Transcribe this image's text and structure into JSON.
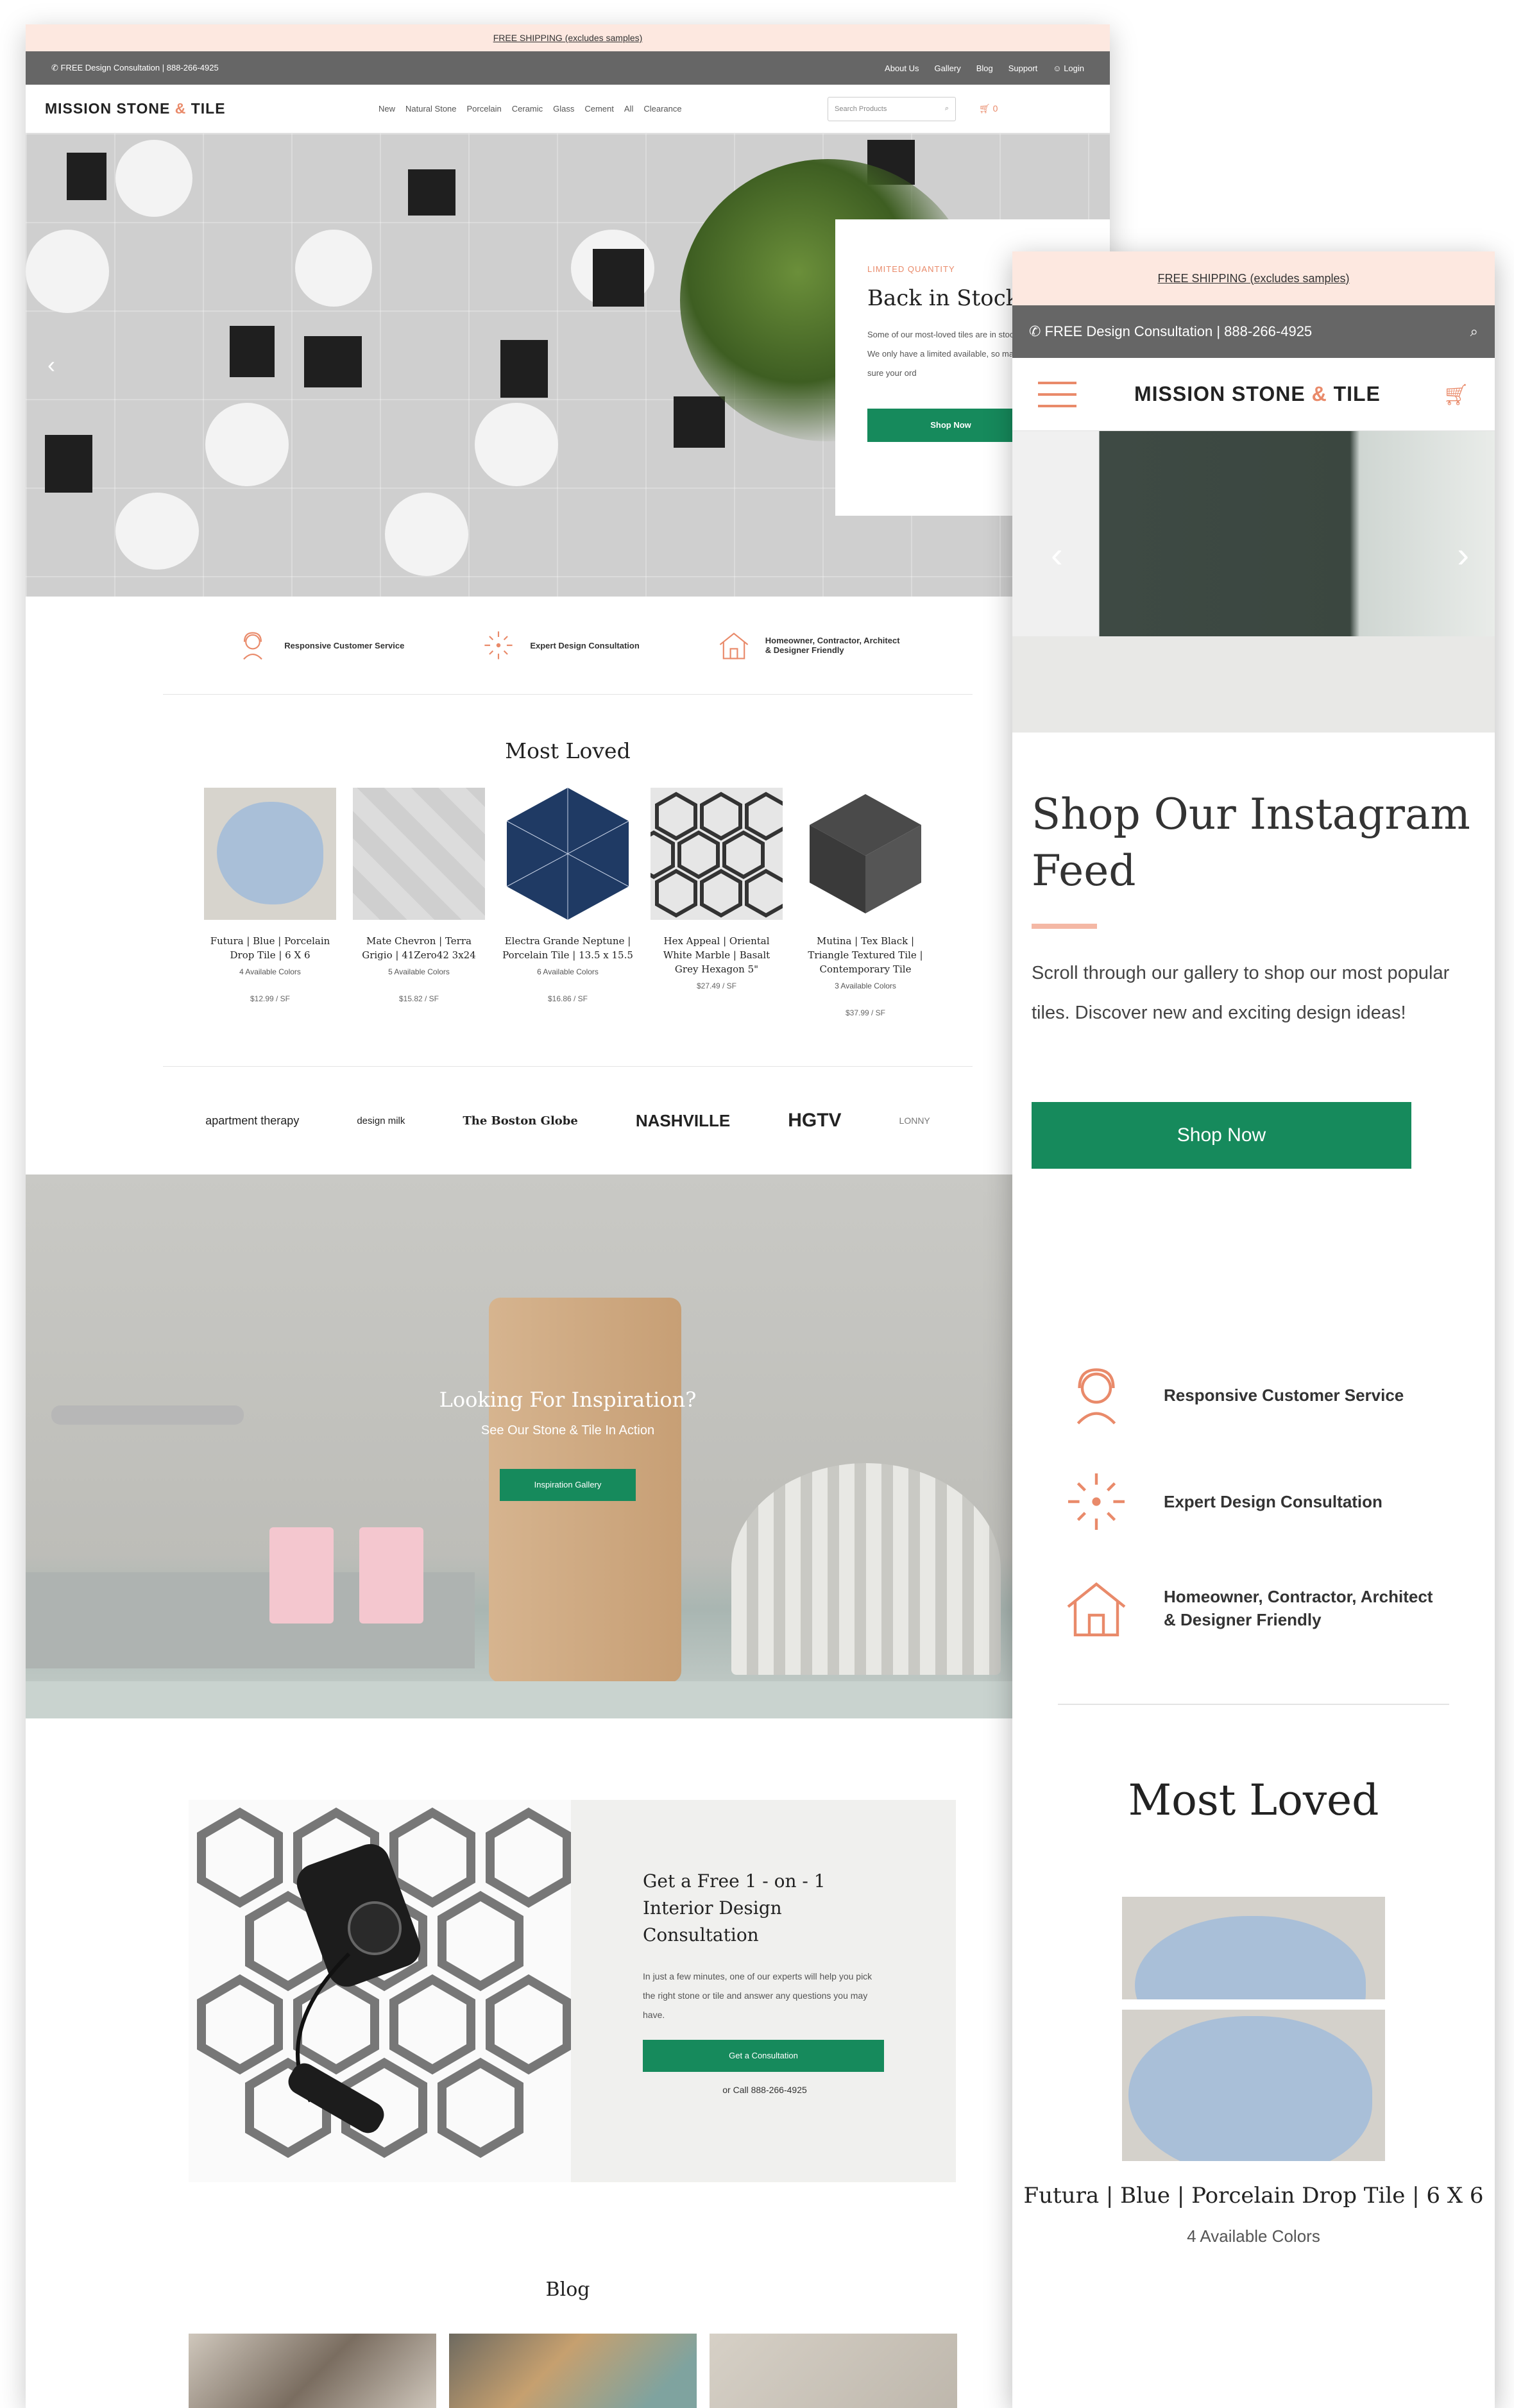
{
  "desktop": {
    "shipping_banner": "FREE SHIPPING (excludes samples)",
    "utility": {
      "phone_text": "FREE Design Consultation | 888-266-4925",
      "links": [
        "About Us",
        "Gallery",
        "Blog",
        "Support",
        "Login"
      ]
    },
    "logo": {
      "part1": "MISSION STONE",
      "amp": "&",
      "part2": "TILE"
    },
    "nav_items": [
      "New",
      "Natural Stone",
      "Porcelain",
      "Ceramic",
      "Glass",
      "Cement",
      "All",
      "Clearance"
    ],
    "search_placeholder": "Search Products",
    "cart_count": "0",
    "hero": {
      "kicker": "LIMITED QUANTITY",
      "title": "Back in Stock",
      "body": "Some of our most-loved tiles are in stock. We only have a limited available, so make sure your ord",
      "button": "Shop Now"
    },
    "features": [
      "Responsive Customer Service",
      "Expert Design Consultation",
      "Homeowner, Contractor, Architect & Designer Friendly"
    ],
    "most_loved_title": "Most Loved",
    "products": [
      {
        "name": "Futura | Blue | Porcelain Drop Tile | 6 X 6",
        "colors": "4 Available Colors",
        "price": "$12.99 / SF"
      },
      {
        "name": "Mate Chevron | Terra Grigio | 41Zero42 3x24",
        "colors": "5 Available Colors",
        "price": "$15.82 / SF"
      },
      {
        "name": "Electra Grande Neptune | Porcelain Tile | 13.5 x 15.5",
        "colors": "6 Available Colors",
        "price": "$16.86 / SF"
      },
      {
        "name": "Hex Appeal | Oriental White Marble | Basalt Grey Hexagon 5\"",
        "colors": "",
        "price": "$27.49 / SF"
      },
      {
        "name": "Mutina | Tex Black | Triangle Textured Tile | Contemporary Tile",
        "colors": "3 Available Colors",
        "price": "$37.99 / SF"
      }
    ],
    "press": [
      "apartment therapy",
      "design milk",
      "The Boston Globe",
      "NASHVILLE",
      "HGTV",
      "LONNY"
    ],
    "inspiration": {
      "title": "Looking For Inspiration?",
      "subtitle": "See Our Stone & Tile In Action",
      "button": "Inspiration Gallery"
    },
    "consultation": {
      "title": "Get a Free 1 - on - 1 Interior Design Consultation",
      "body": "In just a few minutes, one of our experts will help you pick the right stone or tile and answer any questions you may have.",
      "button": "Get a Consultation",
      "call": "or Call 888-266-4925"
    },
    "blog_title": "Blog"
  },
  "mobile": {
    "shipping_banner": "FREE SHIPPING (excludes samples)",
    "phone_text": "FREE Design Consultation | 888-266-4925",
    "logo": {
      "part1": "MISSION STONE",
      "amp": "&",
      "part2": "TILE"
    },
    "hero_title": "Shop Our Instagram Feed",
    "hero_body": "Scroll through our gallery to shop our most popular tiles. Discover new and exciting design ideas!",
    "hero_button": "Shop Now",
    "features": [
      "Responsive Customer Service",
      "Expert Design Consultation",
      "Homeowner, Contractor, Architect & Designer Friendly"
    ],
    "most_loved_title": "Most Loved",
    "product": {
      "name": "Futura | Blue | Porcelain Drop Tile | 6 X 6",
      "colors": "4 Available Colors"
    }
  },
  "colors": {
    "accent": "#e98a6a",
    "green": "#168a5c",
    "banner": "#fde8e0",
    "utility": "#666666"
  }
}
